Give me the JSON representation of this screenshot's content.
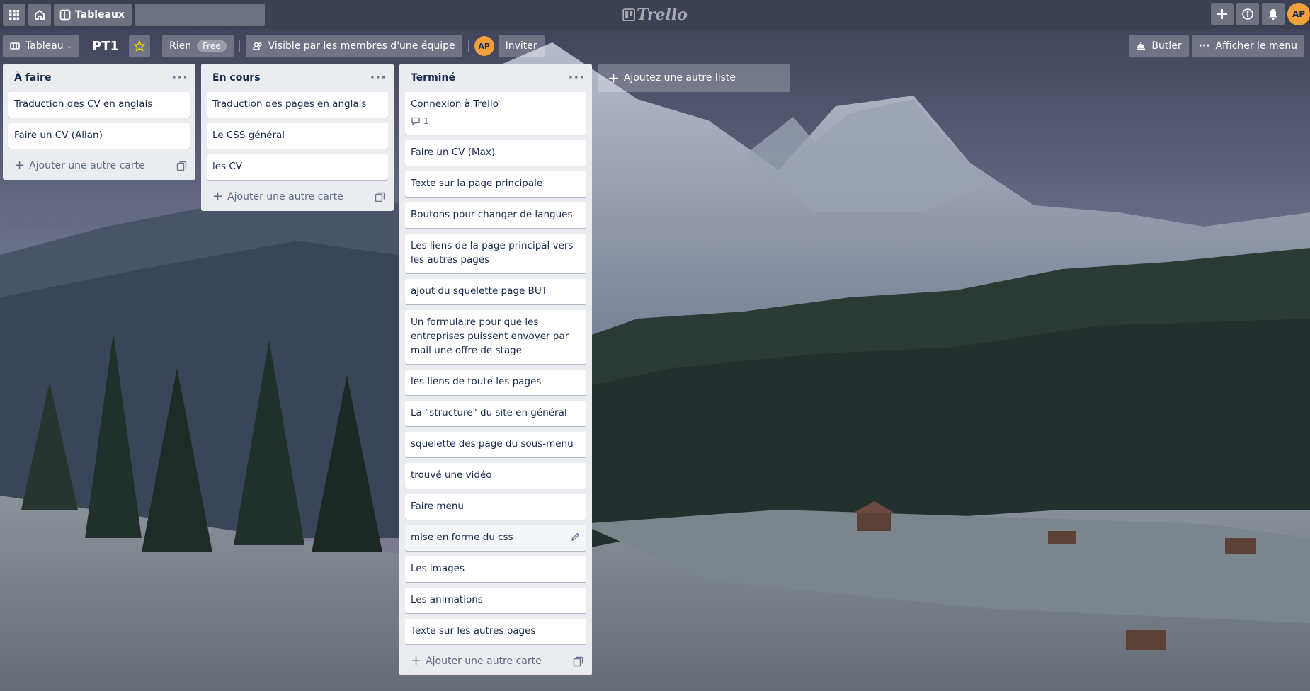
{
  "header": {
    "boards_label": "Tableaux",
    "search_placeholder": "",
    "logo_text": "Trello",
    "user_initials": "AP"
  },
  "board": {
    "view_label": "Tableau",
    "title": "PT1",
    "team_label": "Rien",
    "plan_badge": "Free",
    "visibility_label": "Visible par les membres d'une équipe",
    "member_initials": "AP",
    "invite_label": "Inviter",
    "butler_label": "Butler",
    "menu_label": "Afficher le menu"
  },
  "lists": [
    {
      "title": "À faire",
      "cards": [
        "Traduction des CV en anglais",
        "Faire un CV (Allan)"
      ],
      "add_card_label": "Ajouter une autre carte"
    },
    {
      "title": "En cours",
      "cards": [
        "Traduction des pages en anglais",
        "Le CSS général",
        "les CV"
      ],
      "add_card_label": "Ajouter une autre carte"
    },
    {
      "title": "Terminé",
      "cards": [
        "Connexion à Trello",
        "Faire un CV (Max)",
        "Texte sur la page principale",
        "Boutons pour changer de langues",
        "Les liens de la page principal vers les autres pages",
        "ajout du squelette page BUT",
        "Un formulaire pour que les entreprises puissent envoyer par mail une offre de stage",
        "les liens de toute les pages",
        "La \"structure\" du site en général",
        "squelette des page du sous-menu",
        "trouvé une vidéo",
        "Faire menu",
        "mise en forme du css",
        "Les images",
        "Les animations",
        "Texte sur les autres pages"
      ],
      "first_card_comments": "1",
      "add_card_label": "Ajouter une autre carte"
    }
  ],
  "add_list_label": "Ajoutez une autre liste",
  "colors": {
    "header_bg": "#3c4052",
    "list_bg": "#ebecf0",
    "avatar": "#f2a13a",
    "star": "#f2d600"
  }
}
